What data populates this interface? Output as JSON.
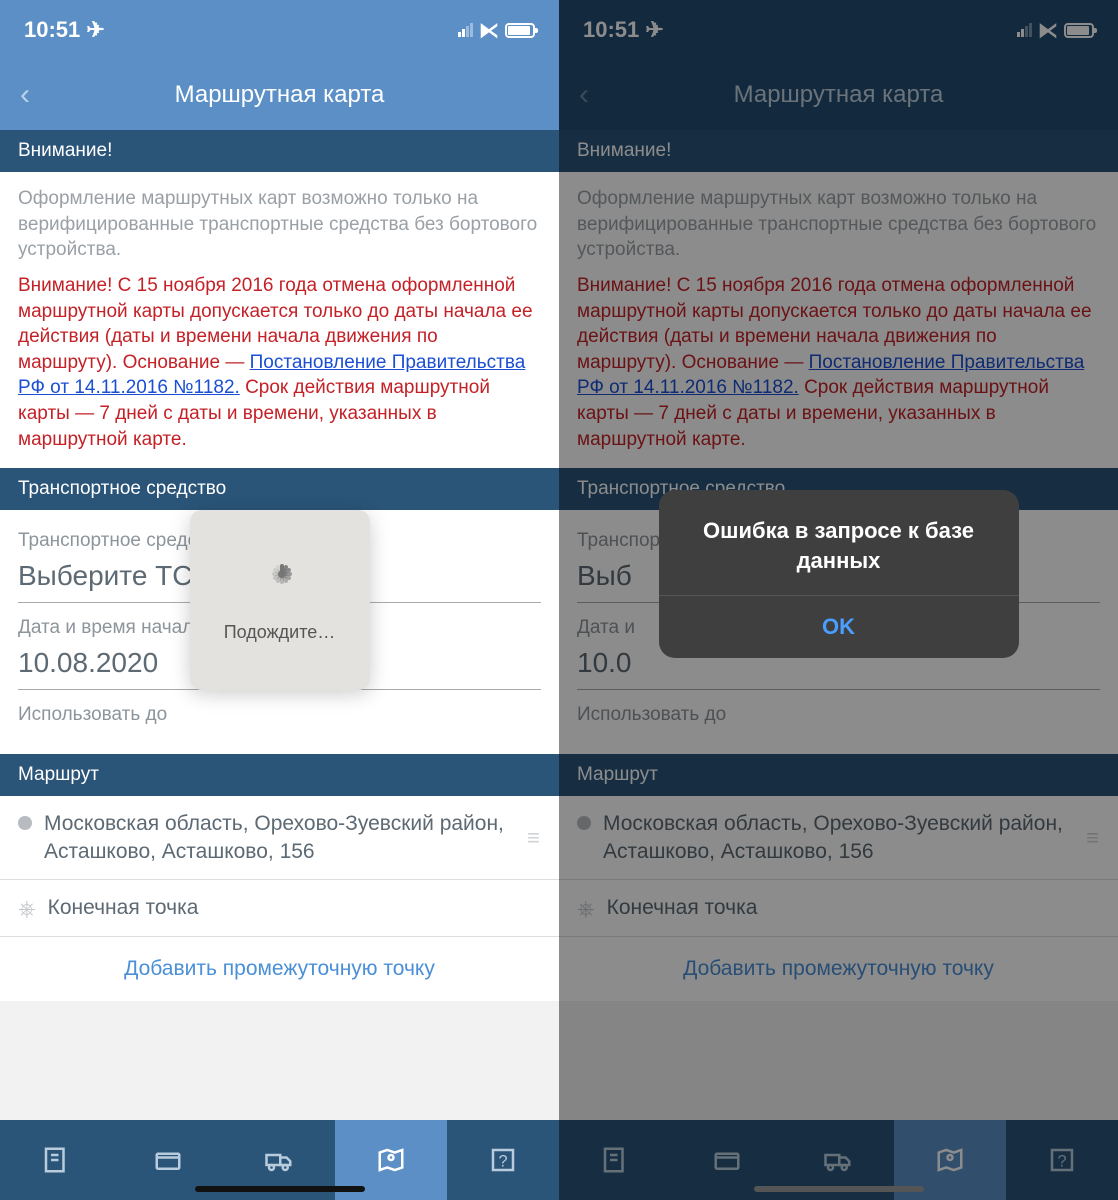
{
  "status": {
    "time": "10:51",
    "location_icon": "location-arrow"
  },
  "header": {
    "title": "Маршрутная карта",
    "back_icon": "chevron-left"
  },
  "attention": {
    "heading": "Внимание!",
    "gray_note": "Оформление маршрутных карт возможно только на верифицированные транспортные средства без бортового устройства.",
    "red_note_before_link": "Внимание! С 15 ноября 2016 года отмена оформленной маршрутной карты допускается только до даты начала ее действия (даты и времени начала движения по маршруту). Основание — ",
    "link_text": "Постановление Правительства РФ от 14.11.2016 №1182.",
    "red_note_after_link": " Срок действия маршрутной карты — 7 дней с даты и времени, указанных в маршрутной карте."
  },
  "vehicle": {
    "heading": "Транспортное средство",
    "field1_label": "Транспортное средство",
    "field1_value": "Выберите ТС",
    "field2_label": "Дата и время начала",
    "field2_value": "10.08.2020",
    "field2_label_short": "Дата и",
    "field2_value_short": "10.0",
    "field1_value_short": "Выб",
    "field3_label": "Использовать до",
    "field3_value": ""
  },
  "route": {
    "heading": "Маршрут",
    "start": "Московская область, Орехово-Зуевский район, Асташково, Асташково, 156",
    "end": "Конечная точка",
    "add_label": "Добавить промежуточную точку"
  },
  "tabs": [
    {
      "name": "receipt-icon",
      "active": false
    },
    {
      "name": "wallet-icon",
      "active": false
    },
    {
      "name": "truck-icon",
      "active": false
    },
    {
      "name": "map-icon",
      "active": true
    },
    {
      "name": "help-icon",
      "active": false
    }
  ],
  "loading": {
    "text": "Подождите…"
  },
  "error": {
    "message": "Ошибка в запросе к базе данных",
    "ok": "OK"
  },
  "colors": {
    "header_left": "#5b8fc6",
    "header_right": "#244c72",
    "section": "#2a5478",
    "red": "#c42127",
    "link": "#1a4fd4",
    "accent": "#4a9eff"
  }
}
